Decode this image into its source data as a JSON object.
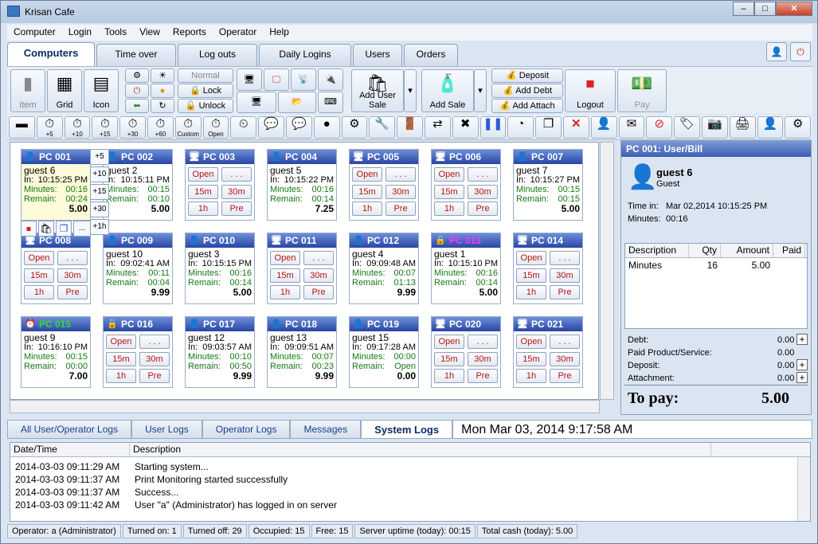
{
  "window": {
    "title": "Krisan Cafe"
  },
  "menu": [
    "Computer",
    "Login",
    "Tools",
    "View",
    "Reports",
    "Operator",
    "Help"
  ],
  "tabs": [
    "Computers",
    "Time over",
    "Log outs",
    "Daily Logins",
    "Users",
    "Orders"
  ],
  "toolbar": {
    "item": "Item",
    "grid": "Grid",
    "icon": "Icon",
    "normal": "Normal",
    "lock": "Lock",
    "unlock": "Unlock",
    "add_user_sale": "Add User Sale",
    "add_sale": "Add Sale",
    "deposit": "Deposit",
    "add_debt": "Add Debt",
    "add_attach": "Add Attach",
    "logout": "Logout",
    "pay": "Pay"
  },
  "toolbar2": [
    {
      "icon": "folder-icon",
      "sub": ""
    },
    {
      "icon": "clock-plus5-icon",
      "sub": "+5"
    },
    {
      "icon": "clock-plus10-icon",
      "sub": "+10"
    },
    {
      "icon": "clock-plus15-icon",
      "sub": "+15"
    },
    {
      "icon": "clock-plus30-icon",
      "sub": "+30"
    },
    {
      "icon": "clock-plus60-icon",
      "sub": "+60"
    },
    {
      "icon": "clock-custom-icon",
      "sub": "Custom"
    },
    {
      "icon": "clock-open-icon",
      "sub": "Open"
    },
    {
      "icon": "clock-settings-icon",
      "sub": ""
    },
    {
      "icon": "chat-icon",
      "sub": ""
    },
    {
      "icon": "chat-green-icon",
      "sub": ""
    },
    {
      "icon": "coin-icon",
      "sub": ""
    },
    {
      "icon": "gear-icon",
      "sub": ""
    },
    {
      "icon": "tools-icon",
      "sub": ""
    },
    {
      "icon": "exit-icon",
      "sub": ""
    },
    {
      "icon": "swap-icon",
      "sub": ""
    },
    {
      "icon": "disconnect-icon",
      "sub": ""
    },
    {
      "icon": "pause-icon",
      "sub": ""
    },
    {
      "icon": "speed-icon",
      "sub": ""
    },
    {
      "icon": "windows-icon",
      "sub": ""
    },
    {
      "icon": "cancel-icon",
      "sub": ""
    },
    {
      "icon": "user-move-icon",
      "sub": ""
    },
    {
      "icon": "message-icon",
      "sub": ""
    },
    {
      "icon": "block-icon",
      "sub": ""
    },
    {
      "icon": "tag-icon",
      "sub": ""
    },
    {
      "icon": "screenshot-icon",
      "sub": ""
    },
    {
      "icon": "print-icon",
      "sub": ""
    },
    {
      "icon": "user-info-icon",
      "sub": ""
    },
    {
      "icon": "network-icon",
      "sub": ""
    }
  ],
  "pcs": [
    {
      "name": "PC 001",
      "guest": "guest 6",
      "in": "10:15:25 PM",
      "minutes": "00:16",
      "remain": "00:24",
      "total": "5.00",
      "status": "user",
      "selected": true
    },
    {
      "name": "PC 002",
      "guest": "guest 2",
      "in": "10:15:11 PM",
      "minutes": "00:15",
      "remain": "00:10",
      "total": "5.00",
      "status": "user"
    },
    {
      "name": "PC 003",
      "status": "idle"
    },
    {
      "name": "PC 004",
      "guest": "guest 5",
      "in": "10:15:22 PM",
      "minutes": "00:16",
      "remain": "00:14",
      "total": "7.25",
      "status": "user"
    },
    {
      "name": "PC 005",
      "status": "idle"
    },
    {
      "name": "PC 006",
      "status": "idle"
    },
    {
      "name": "PC 007",
      "guest": "guest 7",
      "in": "10:15:27 PM",
      "minutes": "00:15",
      "remain": "00:15",
      "total": "5.00",
      "status": "user"
    },
    {
      "name": "PC 008",
      "status": "idle"
    },
    {
      "name": "PC 009",
      "guest": "guest 10",
      "in": "09:02:41 AM",
      "minutes": "00:11",
      "remain": "00:04",
      "total": "9.99",
      "status": "user"
    },
    {
      "name": "PC 010",
      "guest": "guest 3",
      "in": "10:15:15 PM",
      "minutes": "00:16",
      "remain": "00:14",
      "total": "5.00",
      "status": "user"
    },
    {
      "name": "PC 011",
      "status": "idle"
    },
    {
      "name": "PC 012",
      "guest": "guest 4",
      "in": "09:09:48 AM",
      "minutes": "00:07",
      "remain": "01:13",
      "total": "9.99",
      "status": "user"
    },
    {
      "name": "PC 013",
      "guest": "guest 1",
      "in": "10:15:10 PM",
      "minutes": "00:16",
      "remain": "00:14",
      "total": "5.00",
      "status": "locked"
    },
    {
      "name": "PC 014",
      "status": "idle"
    },
    {
      "name": "PC 015",
      "guest": "guest 9",
      "in": "10:16:10 PM",
      "minutes": "00:15",
      "remain": "00:00",
      "total": "7.00",
      "status": "timeover"
    },
    {
      "name": "PC 016",
      "status": "lockedidle"
    },
    {
      "name": "PC 017",
      "guest": "guest 12",
      "in": "09:03:57 AM",
      "minutes": "00:10",
      "remain": "00:50",
      "total": "9.99",
      "status": "user"
    },
    {
      "name": "PC 018",
      "guest": "guest 13",
      "in": "09:09:51 AM",
      "minutes": "00:07",
      "remain": "00:23",
      "total": "9.99",
      "status": "user"
    },
    {
      "name": "PC 019",
      "guest": "guest 15",
      "in": "09:17:28 AM",
      "minutes": "00:00",
      "remain": "Open",
      "total": "0.00",
      "status": "user"
    },
    {
      "name": "PC 020",
      "status": "idle"
    },
    {
      "name": "PC 021",
      "status": "idle"
    }
  ],
  "labels": {
    "in": "In:",
    "minutes": "Minutes:",
    "remain": "Remain:",
    "open": "Open",
    "dots": ". . .",
    "m15": "15m",
    "m30": "30m",
    "h1": "1h",
    "pre": "Pre"
  },
  "popup": [
    "+5",
    "+10",
    "+15",
    "+30",
    "+1h",
    "..."
  ],
  "side": {
    "title": "PC 001: User/Bill",
    "user": "guest 6",
    "role": "Guest",
    "time_in_label": "Time in:",
    "time_in": "Mar 02,2014 10:15:25 PM",
    "minutes_label": "Minutes:",
    "minutes": "00:16",
    "cols": [
      "Description",
      "Qty",
      "Amount",
      "Paid"
    ],
    "rows": [
      [
        "Minutes",
        "16",
        "5.00",
        ""
      ]
    ],
    "debt_label": "Debt:",
    "debt": "0.00",
    "paid_label": "Paid Product/Service:",
    "paid": "0.00",
    "deposit_label": "Deposit:",
    "deposit": "0.00",
    "attach_label": "Attachment:",
    "attach": "0.00",
    "topay_label": "To pay:",
    "topay": "5.00"
  },
  "bottom_tabs": [
    "All User/Operator Logs",
    "User Logs",
    "Operator Logs",
    "Messages",
    "System Logs"
  ],
  "clock": "Mon Mar 03, 2014  9:17:58 AM",
  "logs": {
    "cols": [
      "Date/Time",
      "Description"
    ],
    "rows": [
      [
        "2014-03-03 09:11:29 AM",
        "Starting system..."
      ],
      [
        "2014-03-03 09:11:37 AM",
        "Print Monitoring started successfully"
      ],
      [
        "2014-03-03 09:11:37 AM",
        "Success..."
      ],
      [
        "2014-03-03 09:11:42 AM",
        "User \"a\" (Administrator) has logged in on server"
      ]
    ]
  },
  "status": [
    "Operator: a (Administrator)",
    "Turned on: 1",
    "Turned off: 29",
    "Occupied: 15",
    "Free: 15",
    "Server uptime (today): 00:15",
    "Total cash (today): 5.00"
  ]
}
